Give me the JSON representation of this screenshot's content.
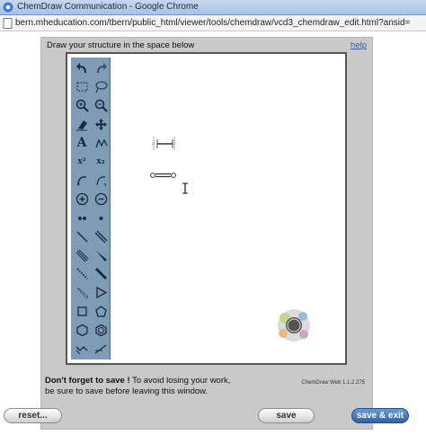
{
  "window": {
    "title": "ChemDraw Communication - Google Chrome",
    "url": "bern.mheducation.com/tbern/public_html/viewer/tools/chemdraw/vcd3_chemdraw_edit.html?ansid="
  },
  "panel": {
    "instruction": "Draw your structure in the space below",
    "help_label": "help"
  },
  "toolbar": {
    "tools": [
      {
        "name": "undo-icon"
      },
      {
        "name": "redo-icon"
      },
      {
        "name": "marquee-select-icon"
      },
      {
        "name": "lasso-select-icon"
      },
      {
        "name": "zoom-in-icon"
      },
      {
        "name": "zoom-out-icon"
      },
      {
        "name": "eraser-icon"
      },
      {
        "name": "move-icon"
      },
      {
        "name": "text-tool-icon",
        "glyph": "A"
      },
      {
        "name": "benzene-ring-icon"
      },
      {
        "name": "superscript-icon",
        "glyph": "x²"
      },
      {
        "name": "subscript-icon",
        "glyph": "x₂"
      },
      {
        "name": "arrow-curved-left-icon"
      },
      {
        "name": "arrow-curved-right-icon"
      },
      {
        "name": "positive-charge-icon"
      },
      {
        "name": "negative-charge-icon"
      },
      {
        "name": "lone-pair-icon"
      },
      {
        "name": "radical-icon"
      },
      {
        "name": "single-bond-icon"
      },
      {
        "name": "double-bond-icon"
      },
      {
        "name": "triple-bond-icon"
      },
      {
        "name": "wedge-bond-icon"
      },
      {
        "name": "hashed-bond-icon"
      },
      {
        "name": "bold-bond-icon"
      },
      {
        "name": "hashed-wedge-bond-icon"
      },
      {
        "name": "triangle-ring-icon"
      },
      {
        "name": "square-ring-icon"
      },
      {
        "name": "pentagon-ring-icon"
      },
      {
        "name": "hexagon-ring-icon"
      },
      {
        "name": "benzene-icon"
      },
      {
        "name": "chain-tool-icon"
      },
      {
        "name": "arrow-tool-icon"
      }
    ]
  },
  "canvas": {
    "bond_end_label": "O"
  },
  "logo": {
    "name": "chemdraw-logo-icon"
  },
  "footer": {
    "save_note_bold": "Don't forget to save !",
    "save_note_line1": "To avoid losing your work,",
    "save_note_line2": "be sure to save before leaving this window.",
    "version": "ChemDraw Web 1.1.2.275"
  },
  "buttons": {
    "reset_label": "reset...",
    "save_label": "save",
    "save_exit_label": "save & exit"
  }
}
